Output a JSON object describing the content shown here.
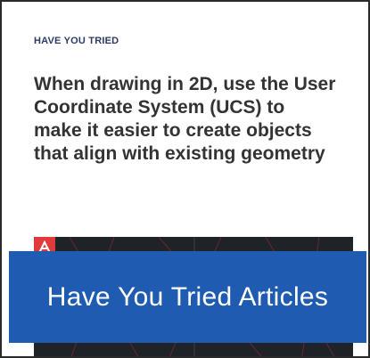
{
  "card": {
    "eyebrow": "HAVE YOU TRIED",
    "headline": "When drawing in 2D, use the User Coordinate System (UCS) to make it easier to create objects that align with existing geometry"
  },
  "thumbnail": {
    "icon": "autocad-logo-icon",
    "background_color": "#1f2327",
    "accent_color": "#e03a3a"
  },
  "banner": {
    "label": "Have You Tried Articles",
    "background_color": "#1f5bb1"
  }
}
